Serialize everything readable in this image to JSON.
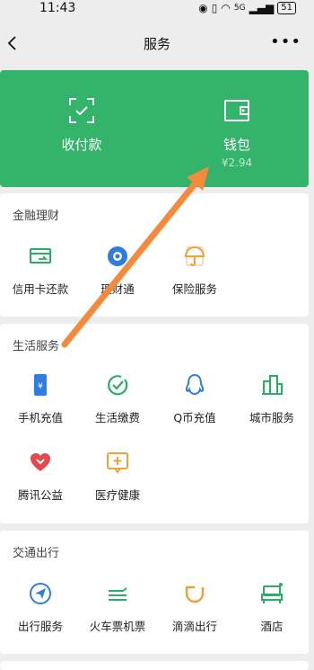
{
  "status": {
    "time": "11:43",
    "signal": "5G",
    "battery": "51"
  },
  "nav": {
    "title": "服务"
  },
  "hero": {
    "pay_label": "收付款",
    "wallet_label": "钱包",
    "wallet_balance": "¥2.94"
  },
  "finance": {
    "title": "金融理财",
    "items": [
      "信用卡还款",
      "理财通",
      "保险服务"
    ]
  },
  "life": {
    "title": "生活服务",
    "items": [
      "手机充值",
      "生活缴费",
      "Q币充值",
      "城市服务",
      "腾讯公益",
      "医疗健康"
    ]
  },
  "travel": {
    "title": "交通出行",
    "items": [
      "出行服务",
      "火车票机票",
      "滴滴出行",
      "酒店"
    ]
  },
  "colors": {
    "brand_green": "#33b46a",
    "icon_green": "#2aae67",
    "icon_blue": "#2f7de1",
    "icon_orange": "#f0a23a",
    "icon_red": "#e5484d",
    "arrow": "#f58a3c"
  }
}
